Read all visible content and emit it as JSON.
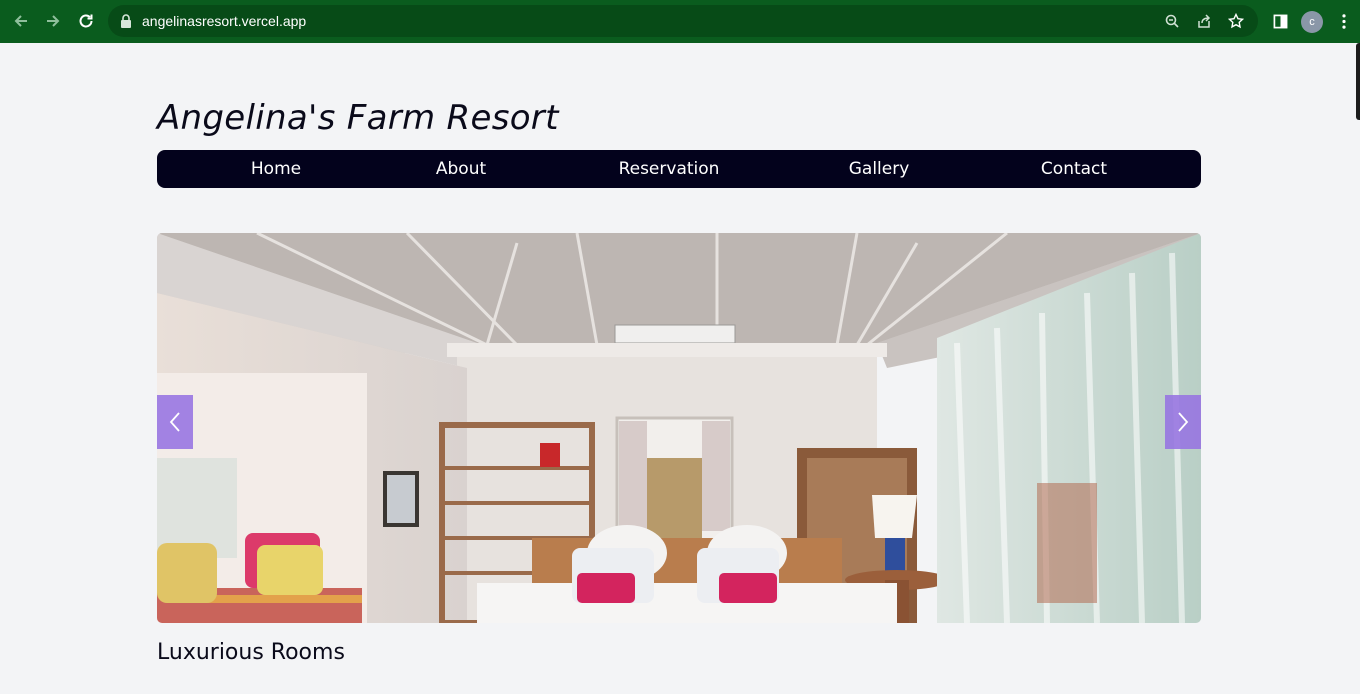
{
  "browser": {
    "url": "angelinasresort.vercel.app",
    "profile_initial": "c",
    "icons": [
      "back-arrow-icon",
      "forward-arrow-icon",
      "reload-icon",
      "lock-icon",
      "zoom-icon",
      "share-icon",
      "star-icon",
      "side-panel-icon",
      "more-vert-icon"
    ]
  },
  "site": {
    "title": "Angelina's Farm Resort"
  },
  "nav": {
    "items": [
      {
        "label": "Home"
      },
      {
        "label": "About"
      },
      {
        "label": "Reservation"
      },
      {
        "label": "Gallery"
      },
      {
        "label": "Contact"
      }
    ]
  },
  "carousel": {
    "image_subject": "resort bedroom",
    "prev_icon": "chevron-left-icon",
    "next_icon": "chevron-right-icon",
    "caption": "Luxurious Rooms"
  },
  "colors": {
    "chrome": "#0a5c1e",
    "nav_bg": "#03021c",
    "page_bg": "#f3f4f6",
    "arrow_bg": "#9673e1"
  }
}
